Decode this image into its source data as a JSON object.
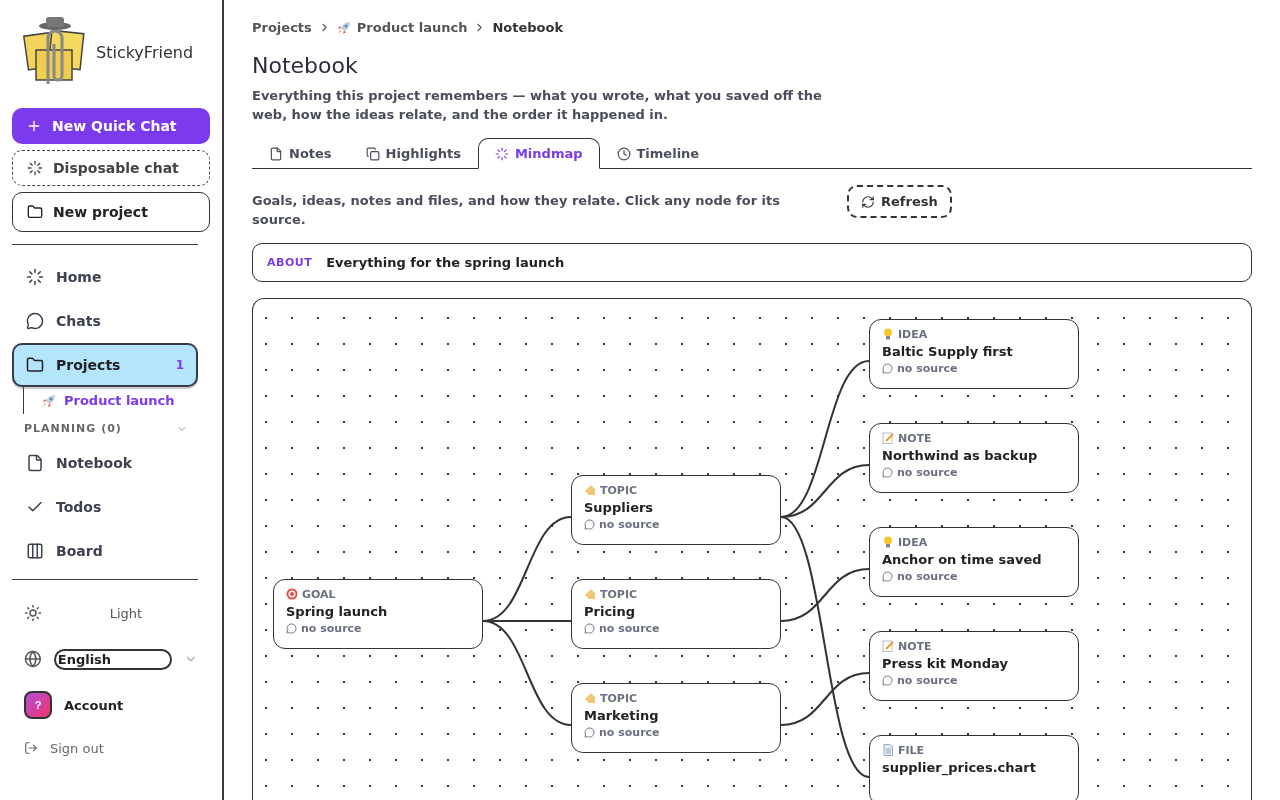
{
  "sidebar": {
    "brand": "StickyFriend",
    "actions": [
      {
        "kind": "primary",
        "label": "New Quick Chat"
      },
      {
        "kind": "dashed",
        "label": "Disposable chat"
      },
      {
        "kind": "outline",
        "label": "New project"
      }
    ],
    "nav": [
      {
        "kind": "home",
        "label": "Home",
        "selected": false
      },
      {
        "kind": "chats",
        "label": "Chats",
        "selected": false
      },
      {
        "kind": "projects",
        "label": "Projects",
        "selected": true,
        "badge": "1",
        "children": [
          {
            "label": "Product launch",
            "selected": true
          }
        ]
      }
    ],
    "section": {
      "title": "PLANNING (0)",
      "expanded": true,
      "items": [
        {
          "kind": "notebook",
          "label": "Notebook"
        },
        {
          "kind": "todos",
          "label": "Todos"
        },
        {
          "kind": "board",
          "label": "Board"
        }
      ]
    },
    "theme": "Light",
    "language": "English",
    "account": {
      "avatar": "?",
      "label": "Account"
    },
    "sign_out": "Sign out"
  },
  "breadcrumbs": [
    "Projects",
    "Product launch",
    "Notebook"
  ],
  "title": "Notebook",
  "description": "Everything this project remembers — what you wrote, what you saved off the web, how the ideas relate, and the order it happened in.",
  "tabs": [
    {
      "kind": "notes",
      "label": "Notes",
      "selected": false
    },
    {
      "kind": "highlights",
      "label": "Highlights",
      "selected": false
    },
    {
      "kind": "mindmap",
      "label": "Mindmap",
      "selected": true
    },
    {
      "kind": "timeline",
      "label": "Timeline",
      "selected": false
    }
  ],
  "mindmap": {
    "hint": "Goals, ideas, notes and files, and how they relate. Click any node for its source.",
    "refresh": "Refresh",
    "about": {
      "label": "ABOUT",
      "text": "Everything for the spring launch"
    },
    "root": {
      "kind": "goal",
      "type": "GOAL",
      "title": "Spring launch",
      "source": "no source",
      "children": [
        {
          "kind": "topic",
          "type": "TOPIC",
          "title": "Suppliers",
          "source": "no source",
          "children": [
            {
              "kind": "idea",
              "type": "IDEA",
              "title": "Baltic Supply first",
              "source": "no source"
            },
            {
              "kind": "note",
              "type": "NOTE",
              "title": "Northwind as backup",
              "source": "no source"
            },
            {
              "kind": "file",
              "type": "FILE",
              "title": "supplier_prices.chart"
            }
          ]
        },
        {
          "kind": "topic",
          "type": "TOPIC",
          "title": "Pricing",
          "source": "no source",
          "children": [
            {
              "kind": "idea",
              "type": "IDEA",
              "title": "Anchor on time saved",
              "source": "no source"
            }
          ]
        },
        {
          "kind": "topic",
          "type": "TOPIC",
          "title": "Marketing",
          "source": "no source",
          "children": [
            {
              "kind": "note",
              "type": "NOTE",
              "title": "Press kit Monday",
              "source": "no source"
            }
          ]
        }
      ]
    }
  }
}
